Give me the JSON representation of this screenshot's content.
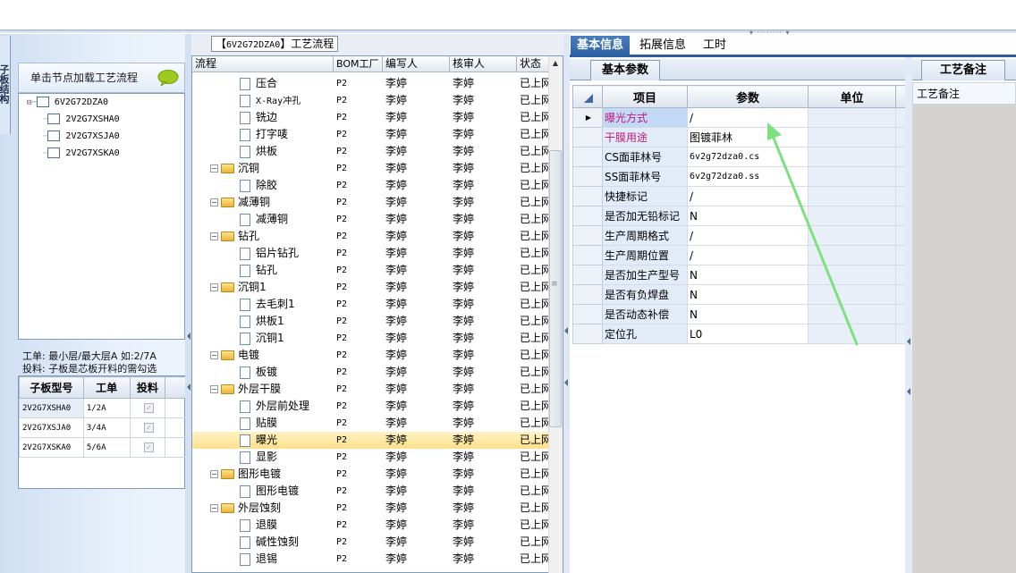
{
  "left": {
    "side_tab": "子板结构",
    "hint": "单击节点加载工艺流程",
    "tree": {
      "root": "6V2G72DZA0",
      "children": [
        "2V2G7XSHA0",
        "2V2G7XSJA0",
        "2V2G7XSKA0"
      ]
    },
    "info_line1": "工单: 最小层/最大层A 如:2/7A",
    "info_line2": "投料: 子板是芯板开料的需勾选",
    "subtable": {
      "headers": [
        "子板型号",
        "工单",
        "投料"
      ],
      "rows": [
        {
          "model": "2V2G7XSHA0",
          "order": "1/2A",
          "feed": "✓"
        },
        {
          "model": "2V2G7XSJA0",
          "order": "3/4A",
          "feed": "✓"
        },
        {
          "model": "2V2G7XSKA0",
          "order": "5/6A",
          "feed": "✓"
        }
      ]
    }
  },
  "middle": {
    "title_prefix": "【",
    "title_code": "6V2G72DZA0",
    "title_suffix": "】工艺流程",
    "headers": {
      "flow": "流程",
      "bom": "BOM工厂",
      "writer": "编写人",
      "reviewer": "核审人",
      "status": "状态"
    },
    "rows": [
      {
        "type": "doc",
        "level": 2,
        "name": "压合",
        "bom": "P2",
        "writer": "李婷",
        "reviewer": "李婷",
        "status": "已上网"
      },
      {
        "type": "doc",
        "level": 2,
        "name": "X-Ray冲孔",
        "bom": "P2",
        "writer": "李婷",
        "reviewer": "李婷",
        "status": "已上网"
      },
      {
        "type": "doc",
        "level": 2,
        "name": "铣边",
        "bom": "P2",
        "writer": "李婷",
        "reviewer": "李婷",
        "status": "已上网"
      },
      {
        "type": "doc",
        "level": 2,
        "name": "打字唛",
        "bom": "P2",
        "writer": "李婷",
        "reviewer": "李婷",
        "status": "已上网"
      },
      {
        "type": "doc",
        "level": 2,
        "name": "烘板",
        "bom": "P2",
        "writer": "李婷",
        "reviewer": "李婷",
        "status": "已上网"
      },
      {
        "type": "folder",
        "level": 1,
        "name": "沉铜",
        "bom": "P2",
        "writer": "李婷",
        "reviewer": "李婷",
        "status": "已上网"
      },
      {
        "type": "doc",
        "level": 2,
        "name": "除胶",
        "bom": "P2",
        "writer": "李婷",
        "reviewer": "李婷",
        "status": "已上网"
      },
      {
        "type": "folder",
        "level": 1,
        "name": "减薄铜",
        "bom": "P2",
        "writer": "李婷",
        "reviewer": "李婷",
        "status": "已上网"
      },
      {
        "type": "doc",
        "level": 2,
        "name": "减薄铜",
        "bom": "P2",
        "writer": "李婷",
        "reviewer": "李婷",
        "status": "已上网"
      },
      {
        "type": "folder",
        "level": 1,
        "name": "钻孔",
        "bom": "P2",
        "writer": "李婷",
        "reviewer": "李婷",
        "status": "已上网"
      },
      {
        "type": "doc",
        "level": 2,
        "name": "铝片钻孔",
        "bom": "P2",
        "writer": "李婷",
        "reviewer": "李婷",
        "status": "已上网"
      },
      {
        "type": "doc",
        "level": 2,
        "name": "钻孔",
        "bom": "P2",
        "writer": "李婷",
        "reviewer": "李婷",
        "status": "已上网"
      },
      {
        "type": "folder",
        "level": 1,
        "name": "沉铜1",
        "bom": "P2",
        "writer": "李婷",
        "reviewer": "李婷",
        "status": "已上网"
      },
      {
        "type": "doc",
        "level": 2,
        "name": "去毛刺1",
        "bom": "P2",
        "writer": "李婷",
        "reviewer": "李婷",
        "status": "已上网"
      },
      {
        "type": "doc",
        "level": 2,
        "name": "烘板1",
        "bom": "P2",
        "writer": "李婷",
        "reviewer": "李婷",
        "status": "已上网"
      },
      {
        "type": "doc",
        "level": 2,
        "name": "沉铜1",
        "bom": "P2",
        "writer": "李婷",
        "reviewer": "李婷",
        "status": "已上网"
      },
      {
        "type": "folder",
        "level": 1,
        "name": "电镀",
        "bom": "P2",
        "writer": "李婷",
        "reviewer": "李婷",
        "status": "已上网"
      },
      {
        "type": "doc",
        "level": 2,
        "name": "板镀",
        "bom": "P2",
        "writer": "李婷",
        "reviewer": "李婷",
        "status": "已上网"
      },
      {
        "type": "folder",
        "level": 1,
        "name": "外层干膜",
        "bom": "P2",
        "writer": "李婷",
        "reviewer": "李婷",
        "status": "已上网"
      },
      {
        "type": "doc",
        "level": 2,
        "name": "外层前处理",
        "bom": "P2",
        "writer": "李婷",
        "reviewer": "李婷",
        "status": "已上网"
      },
      {
        "type": "doc",
        "level": 2,
        "name": "贴膜",
        "bom": "P2",
        "writer": "李婷",
        "reviewer": "李婷",
        "status": "已上网"
      },
      {
        "type": "doc",
        "level": 2,
        "name": "曝光",
        "bom": "P2",
        "writer": "李婷",
        "reviewer": "李婷",
        "status": "已上网",
        "selected": true
      },
      {
        "type": "doc",
        "level": 2,
        "name": "显影",
        "bom": "P2",
        "writer": "李婷",
        "reviewer": "李婷",
        "status": "已上网"
      },
      {
        "type": "folder",
        "level": 1,
        "name": "图形电镀",
        "bom": "P2",
        "writer": "李婷",
        "reviewer": "李婷",
        "status": "已上网"
      },
      {
        "type": "doc",
        "level": 2,
        "name": "图形电镀",
        "bom": "P2",
        "writer": "李婷",
        "reviewer": "李婷",
        "status": "已上网"
      },
      {
        "type": "folder",
        "level": 1,
        "name": "外层蚀刻",
        "bom": "P2",
        "writer": "李婷",
        "reviewer": "李婷",
        "status": "已上网"
      },
      {
        "type": "doc",
        "level": 2,
        "name": "退膜",
        "bom": "P2",
        "writer": "李婷",
        "reviewer": "李婷",
        "status": "已上网"
      },
      {
        "type": "doc",
        "level": 2,
        "name": "碱性蚀刻",
        "bom": "P2",
        "writer": "李婷",
        "reviewer": "李婷",
        "status": "已上网"
      },
      {
        "type": "doc",
        "level": 2,
        "name": "退锡",
        "bom": "P2",
        "writer": "李婷",
        "reviewer": "李婷",
        "status": "已上网"
      }
    ]
  },
  "right": {
    "tabs": [
      "基本信息",
      "拓展信息",
      "工时"
    ],
    "active_tab": 0,
    "basic_tab": "基本参数",
    "table_headers": {
      "item": "项目",
      "param": "参数",
      "unit": "单位"
    },
    "rows": [
      {
        "item": "曝光方式",
        "param": "/",
        "unit": "",
        "pink": true,
        "selected": true
      },
      {
        "item": "干膜用途",
        "param": "图镀菲林",
        "unit": "",
        "pink": true
      },
      {
        "item": "CS面菲林号",
        "param": "6v2g72dza0.cs",
        "unit": "",
        "mono": true
      },
      {
        "item": "SS面菲林号",
        "param": "6v2g72dza0.ss",
        "unit": "",
        "mono": true
      },
      {
        "item": "快捷标记",
        "param": "/",
        "unit": ""
      },
      {
        "item": "是否加无铅标记",
        "param": "N",
        "unit": ""
      },
      {
        "item": "生产周期格式",
        "param": "/",
        "unit": ""
      },
      {
        "item": "生产周期位置",
        "param": "/",
        "unit": ""
      },
      {
        "item": "是否加生产型号",
        "param": "N",
        "unit": ""
      },
      {
        "item": "是否有负焊盘",
        "param": "N",
        "unit": ""
      },
      {
        "item": "是否动态补偿",
        "param": "N",
        "unit": ""
      },
      {
        "item": "定位孔",
        "param": "L0",
        "unit": ""
      }
    ],
    "notes_tab": "工艺备注",
    "notes_label": "工艺备注"
  },
  "colors": {
    "accent": "#2b5ea0",
    "pink_label": "#c01a7a",
    "selection": "#fde08a",
    "arrow": "#7ee07e"
  }
}
